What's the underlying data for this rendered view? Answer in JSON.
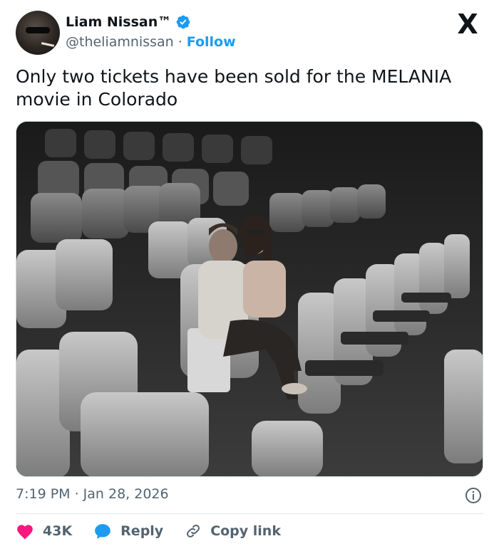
{
  "author": {
    "display_name": "Liam Nissan™",
    "handle": "@theliamnissan",
    "separator": "·",
    "follow_label": "Follow",
    "verified_color": "#1d9bf0"
  },
  "platform_logo": "X",
  "tweet": {
    "text": "Only two tickets have been sold for the MELANIA movie in Colorado",
    "timestamp": "7:19 PM · Jan 28, 2026"
  },
  "media": {
    "description_icon": "photo"
  },
  "actions": {
    "likes": "43K",
    "reply_label": "Reply",
    "copy_label": "Copy link"
  },
  "colors": {
    "accent": "#1d9bf0",
    "like": "#f91880",
    "secondary_text": "#536471"
  }
}
